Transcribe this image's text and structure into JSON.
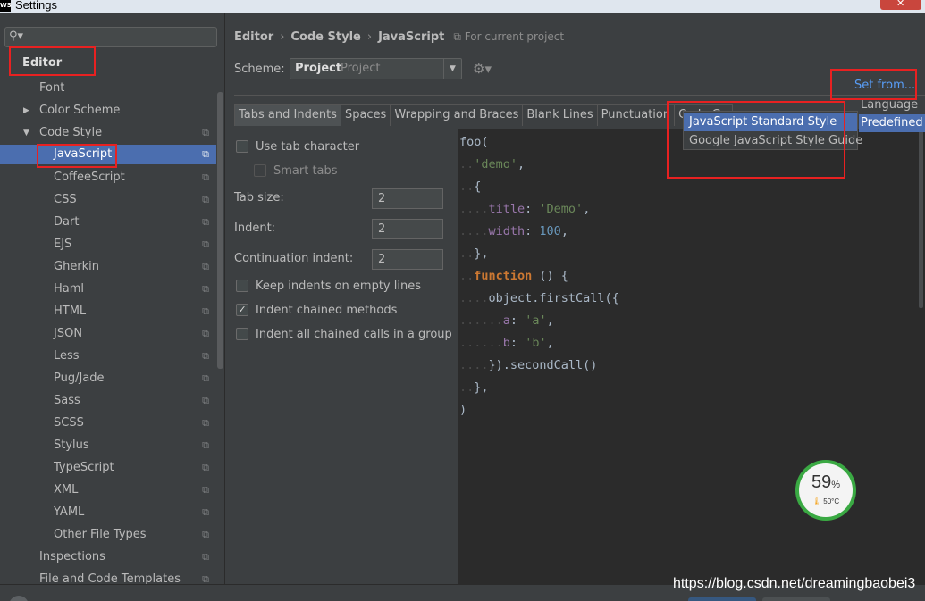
{
  "window": {
    "title": "Settings",
    "logo_text": "WS"
  },
  "sidebar": {
    "search_placeholder": "",
    "items": [
      {
        "label": "Editor"
      },
      {
        "label": "Font"
      },
      {
        "label": "Color Scheme"
      },
      {
        "label": "Code Style"
      },
      {
        "label": "JavaScript"
      },
      {
        "label": "CoffeeScript"
      },
      {
        "label": "CSS"
      },
      {
        "label": "Dart"
      },
      {
        "label": "EJS"
      },
      {
        "label": "Gherkin"
      },
      {
        "label": "Haml"
      },
      {
        "label": "HTML"
      },
      {
        "label": "JSON"
      },
      {
        "label": "Less"
      },
      {
        "label": "Pug/Jade"
      },
      {
        "label": "Sass"
      },
      {
        "label": "SCSS"
      },
      {
        "label": "Stylus"
      },
      {
        "label": "TypeScript"
      },
      {
        "label": "XML"
      },
      {
        "label": "YAML"
      },
      {
        "label": "Other File Types"
      },
      {
        "label": "Inspections"
      },
      {
        "label": "File and Code Templates"
      }
    ]
  },
  "breadcrumb": {
    "part1": "Editor",
    "part2": "Code Style",
    "part3": "JavaScript",
    "scope": "For current project"
  },
  "scheme": {
    "label": "Scheme:",
    "value": "Project",
    "sub": "Project"
  },
  "set_from": "Set from...",
  "tabs": [
    "Tabs and Indents",
    "Spaces",
    "Wrapping and Braces",
    "Blank Lines",
    "Punctuation",
    "Code Ge"
  ],
  "options": {
    "use_tab_character": "Use tab character",
    "smart_tabs": "Smart tabs",
    "tab_size_label": "Tab size:",
    "tab_size": "2",
    "indent_label": "Indent:",
    "indent": "2",
    "continuation_indent_label": "Continuation indent:",
    "continuation_indent": "2",
    "keep_indents": "Keep indents on empty lines",
    "indent_chained": "Indent chained methods",
    "indent_all_chained": "Indent all chained calls in a group"
  },
  "popup": {
    "items": [
      "JavaScript Standard Style",
      "Google JavaScript Style Guide"
    ],
    "submenu": [
      "Language",
      "Predefined S"
    ]
  },
  "gauge": {
    "percent": "59",
    "unit": "%",
    "temp": "50°C"
  },
  "watermark": "https://blog.csdn.net/dreamingbaobei3",
  "colors": {
    "accent": "#4b6eaf",
    "annotation": "#e82121",
    "link": "#589df6"
  }
}
